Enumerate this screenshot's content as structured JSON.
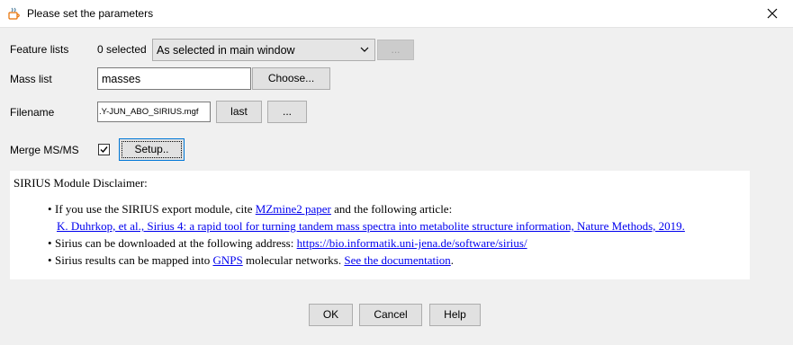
{
  "window": {
    "title": "Please set the parameters",
    "close_icon": "close-icon"
  },
  "feature_lists": {
    "label": "Feature lists",
    "selected": "0 selected",
    "dropdown_value": "As selected in main window",
    "button_label": "..."
  },
  "mass_list": {
    "label": "Mass list",
    "value": "masses",
    "choose_label": "Choose..."
  },
  "filename": {
    "label": "Filename",
    "value": ".Y-JUN_ABO_SIRIUS.mgf",
    "last_label": "last",
    "browse_label": "..."
  },
  "merge": {
    "label": "Merge MS/MS",
    "checked": true,
    "setup_label": "Setup.."
  },
  "disclaimer": {
    "heading": "SIRIUS Module Disclaimer:",
    "b1_pre": "If you use the SIRIUS export module, cite ",
    "b1_link": "MZmine2 paper",
    "b1_post": " and the following article:",
    "b1_article": "K. Duhrkop, et al., Sirius 4: a rapid tool for turning tandem mass spectra into metabolite structure information, Nature Methods, 2019.",
    "b2_pre": "Sirius can be downloaded at the following address: ",
    "b2_link": "https://bio.informatik.uni-jena.de/software/sirius/",
    "b3_pre": "Sirius results can be mapped into ",
    "b3_link1": "GNPS",
    "b3_mid": " molecular networks. ",
    "b3_link2": "See the documentation",
    "b3_post": "."
  },
  "buttons": {
    "ok": "OK",
    "cancel": "Cancel",
    "help": "Help"
  }
}
